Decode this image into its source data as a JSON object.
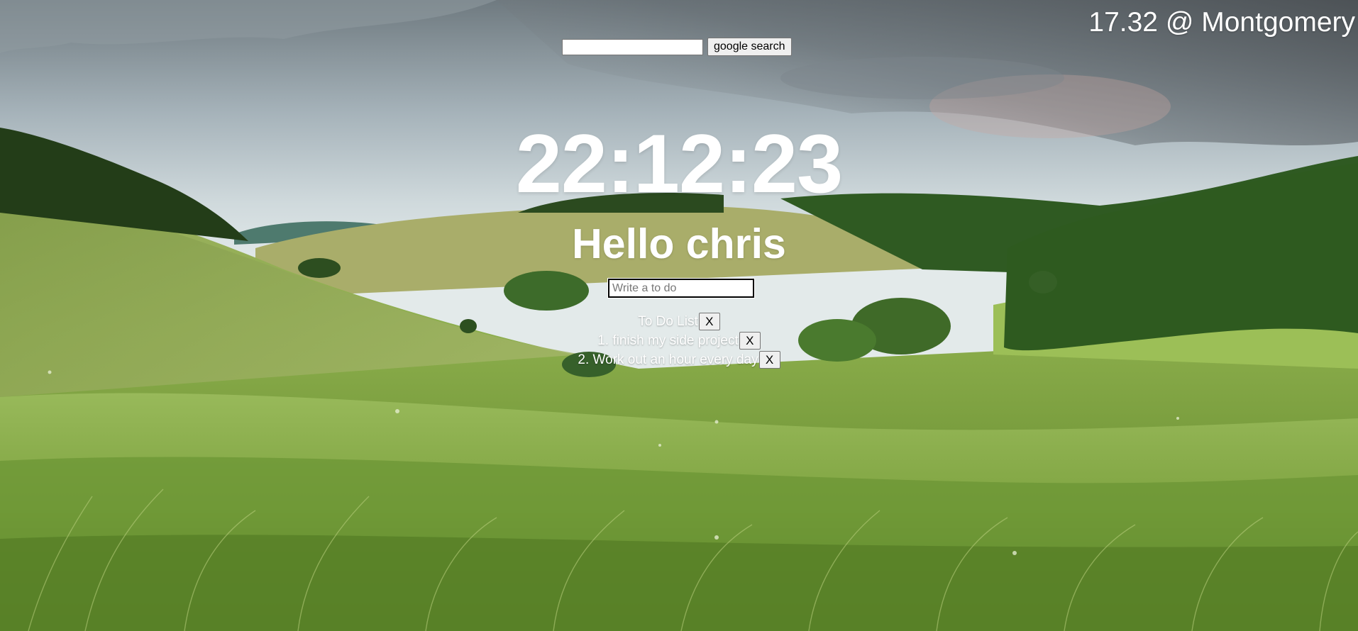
{
  "weather": {
    "text": "17.32 @ Montgomery"
  },
  "search": {
    "value": "",
    "placeholder": "",
    "button_label": "google search"
  },
  "clock": {
    "time": "22:12:23"
  },
  "greeting": {
    "text": "Hello chris"
  },
  "todo": {
    "input_placeholder": "Write a to do",
    "header": "To Do List",
    "delete_label": "X",
    "items": [
      {
        "text": "1. finish my side project"
      },
      {
        "text": "2. Work out an hour every day"
      }
    ]
  },
  "colors": {
    "text": "#ffffff",
    "sky": "#b9c6cd",
    "grass": "#7fa24b"
  }
}
